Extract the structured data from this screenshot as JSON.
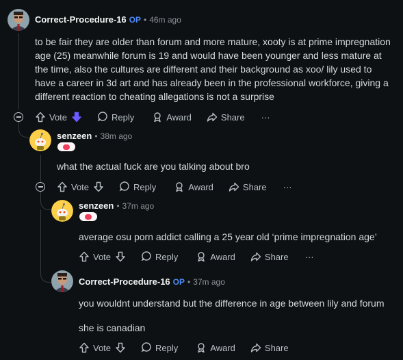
{
  "comments": [
    {
      "username": "Correct-Procedure-16",
      "op_label": "OP",
      "time": "46m ago",
      "text": "to be fair they are older than forum and more mature, xooty is at prime impregnation age (25) meanwhile forum is 19 and would have been younger and less mature at the time, also the cultures are different and their background as xoo/ lily used to have a career in 3d art and has already been in the professional workforce, giving a different reaction to cheating allegations is not a surprise",
      "downvoted": true
    },
    {
      "username": "senzeen",
      "time": "38m ago",
      "text": "what the actual fuck are you talking about bro"
    },
    {
      "username": "senzeen",
      "time": "37m ago",
      "text": "average osu porn addict calling a 25 year old ‘prime impregnation age’"
    },
    {
      "username": "Correct-Procedure-16",
      "op_label": "OP",
      "time": "37m ago",
      "text_lines": [
        "you wouldnt understand but the difference in age between lily and forum",
        "she is canadian"
      ]
    }
  ],
  "actions": {
    "vote": "Vote",
    "reply": "Reply",
    "award": "Award",
    "share": "Share",
    "more": "···"
  },
  "separator": "•",
  "colors": {
    "background": "#0e1113",
    "op": "#4c8bf5",
    "downvote_active": "#6a5cff",
    "flair": "#ef3e5b"
  }
}
